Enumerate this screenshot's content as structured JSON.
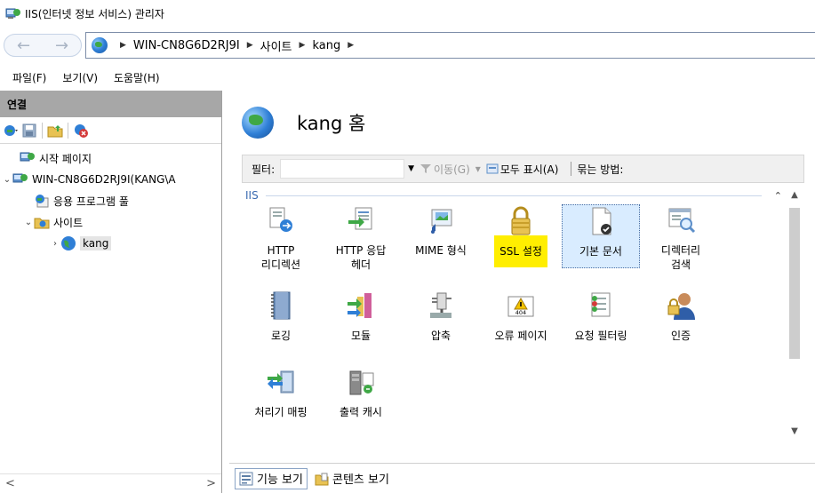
{
  "window": {
    "title": "IIS(인터넷 정보 서비스) 관리자"
  },
  "address": {
    "back": "←",
    "forward": "→",
    "crumbs": [
      "WIN-CN8G6D2RJ9I",
      "사이트",
      "kang"
    ],
    "separator": "▶"
  },
  "menu": {
    "items": [
      "파일(F)",
      "보기(V)",
      "도움말(H)"
    ]
  },
  "left": {
    "header": "연결",
    "tree": [
      {
        "label": "시작 페이지"
      },
      {
        "label": "WIN-CN8G6D2RJ9I(KANG\\A"
      },
      {
        "label": "응용 프로그램 풀"
      },
      {
        "label": "사이트"
      },
      {
        "label": "kang"
      }
    ],
    "scroll_left": "<",
    "scroll_right": ">"
  },
  "right": {
    "title": "kang 홈",
    "filter": {
      "label": "필터:",
      "go": "이동(G)",
      "show_all": "모두 표시(A)",
      "group_by": "묶는 방법:"
    },
    "group": "IIS",
    "features": [
      {
        "label": "HTTP\n리디렉션",
        "icon": "http-redirect-icon"
      },
      {
        "label": "HTTP 응답\n헤더",
        "icon": "http-response-headers-icon"
      },
      {
        "label": "MIME 형식",
        "icon": "mime-types-icon"
      },
      {
        "label": "SSL 설정",
        "icon": "ssl-lock-icon"
      },
      {
        "label": "기본 문서",
        "icon": "default-document-icon"
      },
      {
        "label": "디렉터리\n검색",
        "icon": "directory-browsing-icon"
      },
      {
        "label": "로깅",
        "icon": "logging-icon"
      },
      {
        "label": "모듈",
        "icon": "modules-icon"
      },
      {
        "label": "압축",
        "icon": "compression-icon"
      },
      {
        "label": "오류 페이지",
        "icon": "error-pages-icon"
      },
      {
        "label": "요청 필터링",
        "icon": "request-filtering-icon"
      },
      {
        "label": "인증",
        "icon": "authentication-icon"
      },
      {
        "label": "처리기 매핑",
        "icon": "handler-mappings-icon"
      },
      {
        "label": "출력 캐시",
        "icon": "output-caching-icon"
      }
    ],
    "error_code": "404",
    "views": {
      "features": "기능 보기",
      "content": "콘텐츠 보기"
    }
  },
  "colors": {
    "highlight": "#ffee00",
    "selection": "#d9ecff",
    "left_header": "#a7a7a7"
  }
}
